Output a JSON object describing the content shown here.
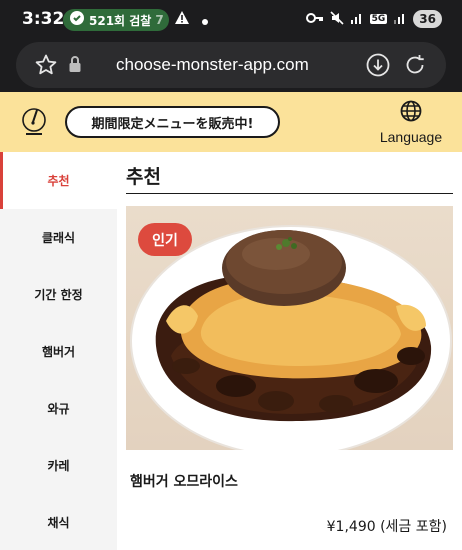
{
  "status_bar": {
    "time": "3:32",
    "notification_text": "521회 검찰",
    "notification_count": "7",
    "network": "5G",
    "battery": "36"
  },
  "browser": {
    "url": "choose-monster-app.com"
  },
  "header": {
    "promo_label": "期間限定メニューを販売中!",
    "language_label": "Language"
  },
  "sidebar": {
    "items": [
      {
        "label": "추천",
        "active": true
      },
      {
        "label": "클래식",
        "active": false
      },
      {
        "label": "기간 한정",
        "active": false
      },
      {
        "label": "햄버거",
        "active": false
      },
      {
        "label": "와규",
        "active": false
      },
      {
        "label": "카레",
        "active": false
      },
      {
        "label": "채식",
        "active": false
      }
    ]
  },
  "main": {
    "section_title": "추천",
    "card": {
      "badge": "인기",
      "name": "햄버거 오므라이스",
      "price": "¥1,490",
      "price_note": "(세금 포함)"
    }
  },
  "colors": {
    "accent": "#d9413a",
    "header_bg": "#fbe29a",
    "badge_bg": "#dd4a3e"
  }
}
